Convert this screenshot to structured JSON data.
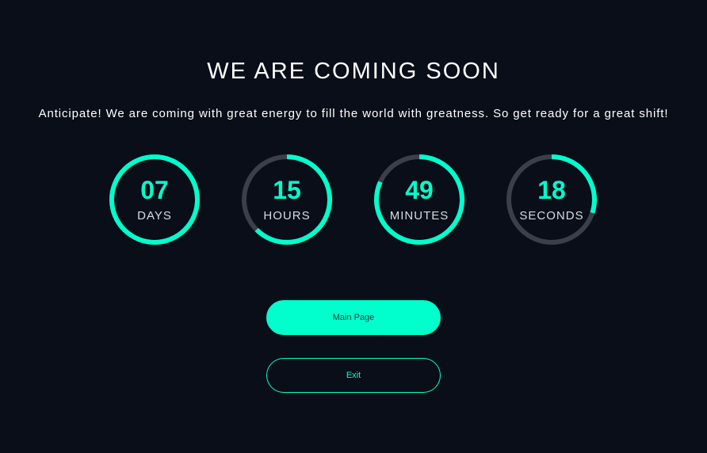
{
  "header": {
    "title": "WE ARE COMING SOON",
    "subtitle": "Anticipate! We are coming with great energy to fill the world with greatness. So get ready for a great shift!"
  },
  "countdown": [
    {
      "value": "07",
      "unit": "DAYS",
      "progress": 1.0
    },
    {
      "value": "15",
      "unit": "HOURS",
      "progress": 0.625
    },
    {
      "value": "49",
      "unit": "MINUTES",
      "progress": 0.817
    },
    {
      "value": "18",
      "unit": "SECONDS",
      "progress": 0.3
    }
  ],
  "buttons": {
    "main_label": "Main Page",
    "exit_label": "Exit"
  },
  "colors": {
    "background": "#090e18",
    "accent": "#00ffcc",
    "track": "#3a3f4b",
    "text": "#ffffff"
  }
}
